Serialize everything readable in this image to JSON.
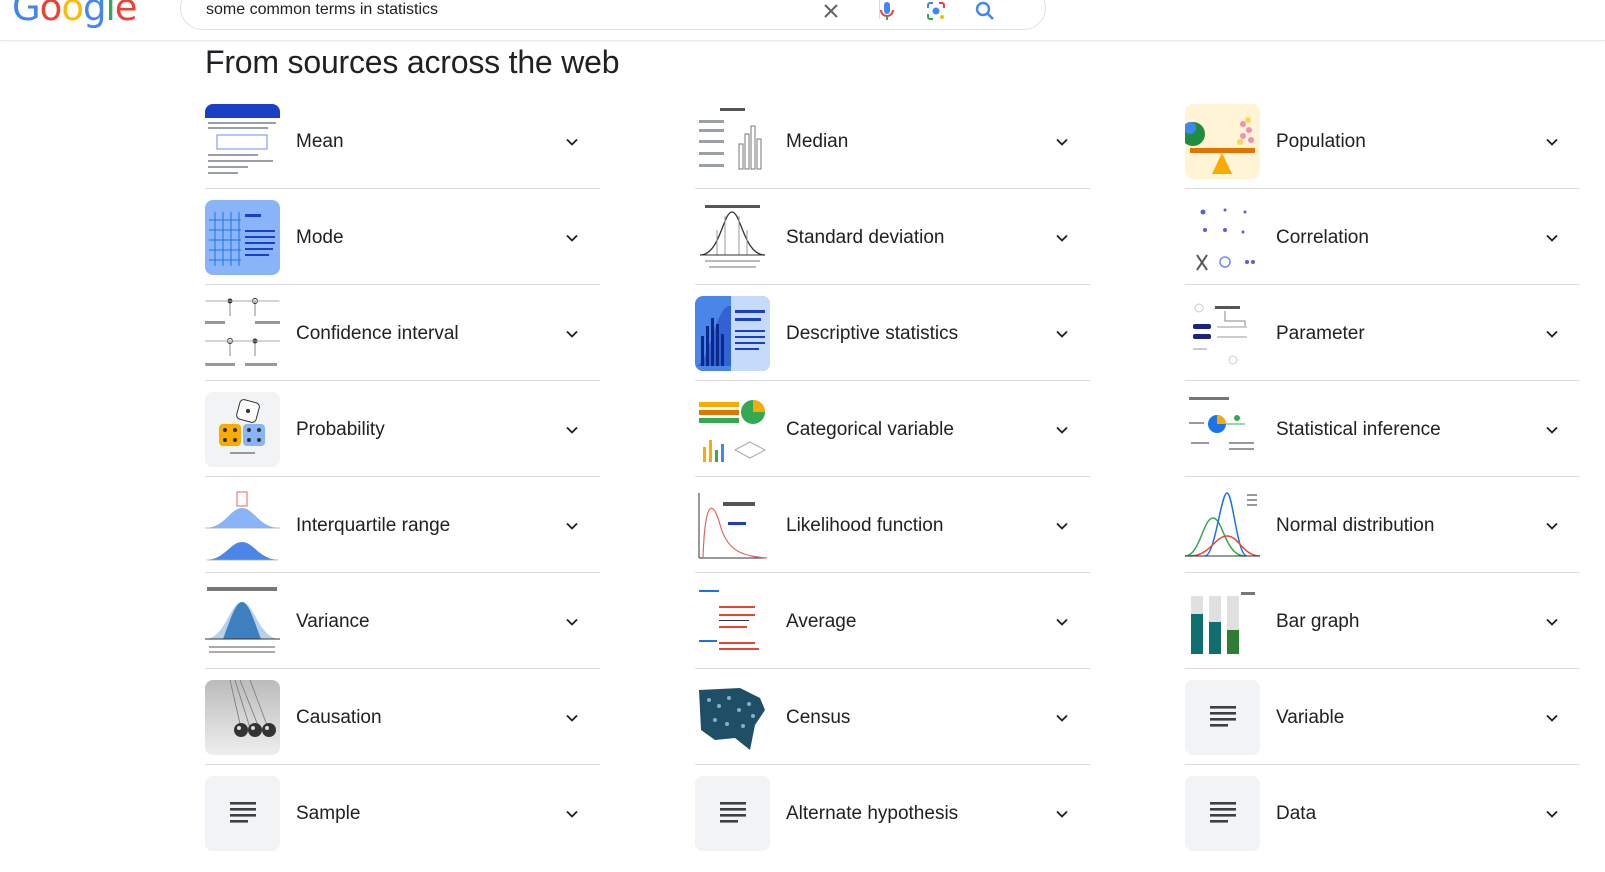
{
  "logo_text": "Google",
  "search": {
    "query": "some common terms in statistics"
  },
  "heading": "From sources across the web",
  "columns": [
    {
      "items": [
        {
          "label": "Mean",
          "thumb": "mean-thumb"
        },
        {
          "label": "Mode",
          "thumb": "mode-thumb"
        },
        {
          "label": "Confidence interval",
          "thumb": "interval-thumb"
        },
        {
          "label": "Probability",
          "thumb": "dice-thumb"
        },
        {
          "label": "Interquartile range",
          "thumb": "bell-blue-thumb"
        },
        {
          "label": "Variance",
          "thumb": "bell-shaded-thumb"
        },
        {
          "label": "Causation",
          "thumb": "cradle-thumb"
        },
        {
          "label": "Sample",
          "thumb": "doc-icon"
        }
      ]
    },
    {
      "items": [
        {
          "label": "Median",
          "thumb": "median-thumb"
        },
        {
          "label": "Standard deviation",
          "thumb": "normal-curve-thumb"
        },
        {
          "label": "Descriptive statistics",
          "thumb": "stats-thumb"
        },
        {
          "label": "Categorical variable",
          "thumb": "charts-thumb"
        },
        {
          "label": "Likelihood function",
          "thumb": "likelihood-thumb"
        },
        {
          "label": "Average",
          "thumb": "formula-thumb"
        },
        {
          "label": "Census",
          "thumb": "map-thumb"
        },
        {
          "label": "Alternate hypothesis",
          "thumb": "doc-icon"
        }
      ]
    },
    {
      "items": [
        {
          "label": "Population",
          "thumb": "balance-thumb"
        },
        {
          "label": "Correlation",
          "thumb": "scatter-thumb"
        },
        {
          "label": "Parameter",
          "thumb": "diagram-thumb"
        },
        {
          "label": "Statistical inference",
          "thumb": "inference-thumb"
        },
        {
          "label": "Normal distribution",
          "thumb": "curves-thumb"
        },
        {
          "label": "Bar graph",
          "thumb": "bars-thumb"
        },
        {
          "label": "Variable",
          "thumb": "doc-icon"
        },
        {
          "label": "Data",
          "thumb": "doc-icon"
        }
      ]
    }
  ],
  "colors": {
    "google_blue": "#4285F4",
    "google_red": "#EA4335",
    "google_yellow": "#FBBC05",
    "google_green": "#34A853",
    "text": "#202124",
    "divider": "#dadce0"
  }
}
